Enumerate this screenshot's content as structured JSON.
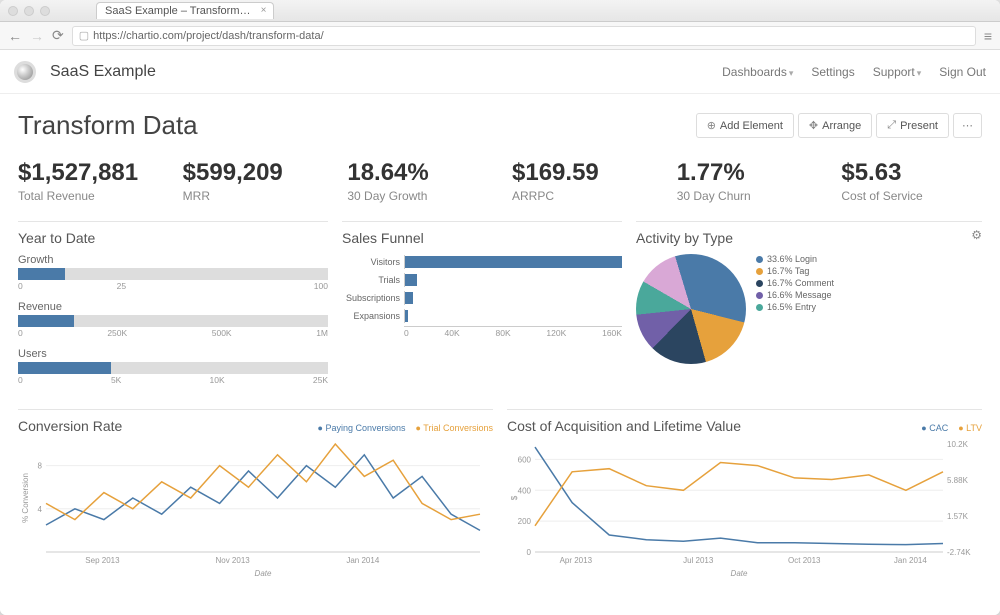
{
  "browser": {
    "tab_title": "SaaS Example – Transform…",
    "url": "https://chartio.com/project/dash/transform-data/"
  },
  "header": {
    "brand": "SaaS Example",
    "nav": {
      "dashboards": "Dashboards",
      "settings": "Settings",
      "support": "Support",
      "signout": "Sign Out"
    }
  },
  "page": {
    "title": "Transform Data",
    "buttons": {
      "add": "Add Element",
      "arrange": "Arrange",
      "present": "Present"
    }
  },
  "kpis": [
    {
      "value": "$1,527,881",
      "label": "Total Revenue"
    },
    {
      "value": "$599,209",
      "label": "MRR"
    },
    {
      "value": "18.64%",
      "label": "30 Day Growth"
    },
    {
      "value": "$169.59",
      "label": "ARRPC"
    },
    {
      "value": "1.77%",
      "label": "30 Day Churn"
    },
    {
      "value": "$5.63",
      "label": "Cost of Service"
    }
  ],
  "ytd": {
    "title": "Year to Date",
    "rows": [
      {
        "label": "Growth",
        "ticks": [
          "0",
          "25",
          "",
          "100"
        ]
      },
      {
        "label": "Revenue",
        "ticks": [
          "0",
          "250K",
          "500K",
          "1M"
        ]
      },
      {
        "label": "Users",
        "ticks": [
          "0",
          "5K",
          "10K",
          "25K"
        ]
      }
    ]
  },
  "funnel": {
    "title": "Sales Funnel",
    "xticks": [
      "0",
      "40K",
      "80K",
      "120K",
      "160K"
    ]
  },
  "activity": {
    "title": "Activity by Type"
  },
  "conv": {
    "title": "Conversion Rate",
    "legend": {
      "a": "Paying Conversions",
      "b": "Trial Conversions"
    },
    "ylabel": "% Conversion",
    "xlabel": "Date"
  },
  "cac": {
    "title": "Cost of Acquisition and Lifetime Value",
    "legend": {
      "a": "CAC",
      "b": "LTV"
    },
    "ylabel": "$",
    "xlabel": "Date"
  },
  "colors": {
    "blue": "#4a7aa8",
    "orange": "#e6a13c",
    "purple": "#7160a8",
    "teal": "#4aa89b",
    "darkblue": "#2b4560",
    "pink": "#d9a8d6"
  },
  "chart_data": [
    {
      "type": "bar",
      "title": "Year to Date",
      "series": [
        {
          "name": "Growth",
          "value": 15,
          "max": 100,
          "ticks": [
            0,
            25,
            100
          ]
        },
        {
          "name": "Revenue",
          "value": 180000,
          "max": 1000000,
          "ticks": [
            0,
            250000,
            500000,
            1000000
          ]
        },
        {
          "name": "Users",
          "value": 7500,
          "max": 25000,
          "ticks": [
            0,
            5000,
            10000,
            25000
          ]
        }
      ]
    },
    {
      "type": "bar",
      "title": "Sales Funnel",
      "orientation": "horizontal",
      "categories": [
        "Visitors",
        "Trials",
        "Subscriptions",
        "Expansions"
      ],
      "values": [
        160000,
        9000,
        6000,
        2000
      ],
      "xlim": [
        0,
        160000
      ],
      "xticks": [
        0,
        40000,
        80000,
        120000,
        160000
      ]
    },
    {
      "type": "pie",
      "title": "Activity by Type",
      "slices": [
        {
          "name": "Login",
          "pct": 33.6,
          "color": "#4a7aa8"
        },
        {
          "name": "Tag",
          "pct": 16.7,
          "color": "#e6a13c"
        },
        {
          "name": "Comment",
          "pct": 16.7,
          "color": "#2b4560"
        },
        {
          "name": "Message",
          "pct": 16.6,
          "color": "#7160a8"
        },
        {
          "name": "Entry",
          "pct": 16.5,
          "color": "#4aa89b"
        }
      ],
      "legend_labels": [
        "33.6% Login",
        "16.7% Tag",
        "16.7% Comment",
        "16.6% Message",
        "16.5% Entry"
      ]
    },
    {
      "type": "line",
      "title": "Conversion Rate",
      "xlabel": "Date",
      "ylabel": "% Conversion",
      "ylim": [
        0,
        10
      ],
      "yticks": [
        4,
        8
      ],
      "x": [
        "Aug 2013",
        "Sep 2013",
        "Oct 2013",
        "Nov 2013",
        "Dec 2013",
        "Jan 2014",
        "Feb 2014",
        "Mar 2014"
      ],
      "xticks_shown": [
        "Sep 2013",
        "Nov 2013",
        "Jan 2014"
      ],
      "series": [
        {
          "name": "Paying Conversions",
          "color": "#4a7aa8",
          "values": [
            2.5,
            4.0,
            3.0,
            5.0,
            3.5,
            6.0,
            4.5,
            7.5,
            5.0,
            8.0,
            6.0,
            9.0,
            5.0,
            7.0,
            3.5,
            2.0
          ]
        },
        {
          "name": "Trial Conversions",
          "color": "#e6a13c",
          "values": [
            4.5,
            3.0,
            5.5,
            4.0,
            6.5,
            5.0,
            8.0,
            6.0,
            9.0,
            6.5,
            10.0,
            7.0,
            8.5,
            4.5,
            3.0,
            3.5
          ]
        }
      ]
    },
    {
      "type": "line",
      "title": "Cost of Acquisition and Lifetime Value",
      "xlabel": "Date",
      "ylabel_left": "$",
      "ylim_left": [
        0,
        700
      ],
      "yticks_left": [
        0,
        200,
        400,
        600
      ],
      "yticks_right": [
        "-2.74K",
        "1.57K",
        "5.88K",
        "10.2K"
      ],
      "x": [
        "Mar 2013",
        "Apr 2013",
        "May 2013",
        "Jun 2013",
        "Jul 2013",
        "Aug 2013",
        "Sep 2013",
        "Oct 2013",
        "Nov 2013",
        "Dec 2013",
        "Jan 2014",
        "Feb 2014"
      ],
      "xticks_shown": [
        "Apr 2013",
        "Jul 2013",
        "Oct 2013",
        "Jan 2014"
      ],
      "series": [
        {
          "name": "CAC",
          "axis": "left",
          "color": "#4a7aa8",
          "values": [
            680,
            320,
            110,
            80,
            70,
            90,
            60,
            60,
            55,
            50,
            48,
            55
          ]
        },
        {
          "name": "LTV",
          "axis": "right",
          "color": "#e6a13c",
          "values": [
            170,
            520,
            540,
            430,
            400,
            580,
            560,
            480,
            470,
            500,
            400,
            520
          ]
        }
      ]
    }
  ]
}
